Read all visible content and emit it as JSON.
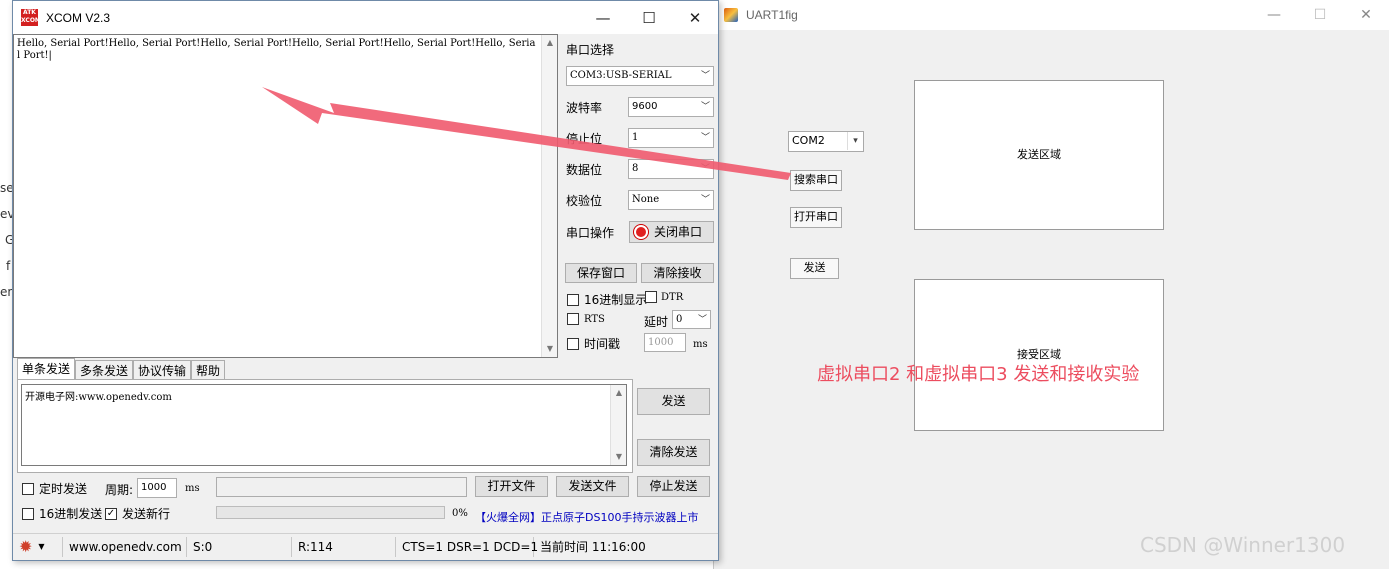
{
  "background": {
    "fragments": [
      "se",
      "ev",
      "G",
      "f",
      "en"
    ]
  },
  "uart": {
    "title": "UART1fig",
    "controls": {
      "minimize": "—",
      "maximize": "☐",
      "close": "✕"
    },
    "port_select": "COM2",
    "search_button": "搜索串口",
    "open_button": "打开串口",
    "send_button": "发送",
    "send_area_label": "发送区域",
    "recv_area_label": "接受区域"
  },
  "annotation": "虚拟串口2 和虚拟串口3 发送和接收实验",
  "watermark": "CSDN @Winner1300",
  "xcom": {
    "logo_text": "ATK XCOM",
    "title": "XCOM V2.3",
    "controls": {
      "minimize": "—",
      "maximize": "☐",
      "close": "✕"
    },
    "receive_text": "Hello, Serial Port!Hello, Serial Port!Hello, Serial Port!Hello, Serial Port!Hello, Serial Port!Hello, Serial Port!|",
    "settings": {
      "port_label": "串口选择",
      "port_value": "COM3:USB-SERIAL",
      "baud_label": "波特率",
      "baud_value": "9600",
      "stopbits_label": "停止位",
      "stopbits_value": "1",
      "databits_label": "数据位",
      "databits_value": "8",
      "parity_label": "校验位",
      "parity_value": "None",
      "op_label": "串口操作",
      "op_button": "关闭串口"
    },
    "save_window": "保存窗口",
    "clear_receive": "清除接收",
    "hex_display": "16进制显示",
    "dtr": "DTR",
    "rts": "RTS",
    "delay_label": "延时",
    "delay_value": "0",
    "timestamp": "时间戳",
    "timestamp_value": "1000",
    "timestamp_unit": "ms",
    "tabs": [
      "单条发送",
      "多条发送",
      "协议传输",
      "帮助"
    ],
    "send_text": "开源电子网:www.openedv.com",
    "send_button": "发送",
    "clear_send": "清除发送",
    "timed_send": "定时发送",
    "period_label": "周期:",
    "period_value": "1000",
    "period_unit": "ms",
    "open_file": "打开文件",
    "send_file": "发送文件",
    "stop_send": "停止发送",
    "hex_send": "16进制发送",
    "send_newline": "发送新行",
    "progress_percent": "0%",
    "progress_value": 0,
    "ad_text": "【火爆全网】正点原子DS100手持示波器上市",
    "status": {
      "url": "www.openedv.com",
      "sent": "S:0",
      "received": "R:114",
      "lines": "CTS=1 DSR=1 DCD=1",
      "time": "当前时间 11:16:00"
    }
  }
}
